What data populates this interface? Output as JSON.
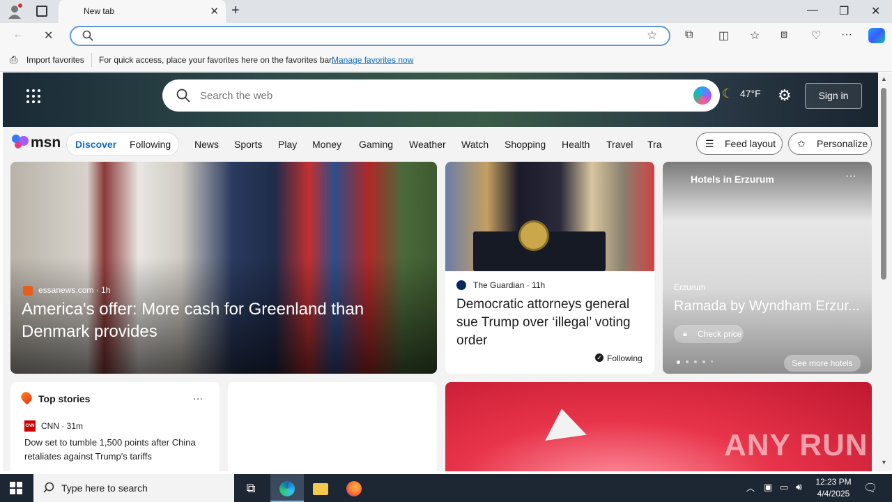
{
  "browser": {
    "tab_title": "New tab",
    "address_value": "",
    "favbar_import": "Import favorites",
    "favbar_hint": "For quick access, place your favorites here on the favorites bar.",
    "favbar_manage": "Manage favorites now"
  },
  "msn": {
    "search_placeholder": "Search the web",
    "temperature": "47°F",
    "sign_in": "Sign in",
    "logo": "msn",
    "tabs": {
      "discover": "Discover",
      "following": "Following"
    },
    "nav": [
      "News",
      "Sports",
      "Play",
      "Money",
      "Gaming",
      "Weather",
      "Watch",
      "Shopping",
      "Health",
      "Travel",
      "Tra"
    ],
    "feed_layout": "Feed layout",
    "personalize": "Personalize",
    "big_card": {
      "source": "essanews.com · 1h",
      "headline": "America's offer: More cash for Greenland than Denmark provides"
    },
    "guardian_card": {
      "source": "The Guardian · 11h",
      "headline": "Democratic attorneys general sue Trump over ‘illegal’ voting order",
      "following": "Following"
    },
    "hotel_card": {
      "title": "Hotels in Erzurum",
      "city": "Erzurum",
      "name": "Ramada by Wyndham Erzur...",
      "check_price": "Check price",
      "see_more": "See more hotels"
    },
    "top_stories": {
      "title": "Top stories",
      "source": "CNN · 31m",
      "source_logo": "CNN",
      "headline": "Dow set to tumble 1,500 points after China retaliates against Trump's tariffs"
    },
    "watermark": "ANY RUN"
  },
  "taskbar": {
    "search_placeholder": "Type here to search",
    "time": "12:23 PM",
    "date": "4/4/2025"
  },
  "colors": {
    "accent": "#0f6cbd",
    "taskbar": "#1c2733"
  }
}
